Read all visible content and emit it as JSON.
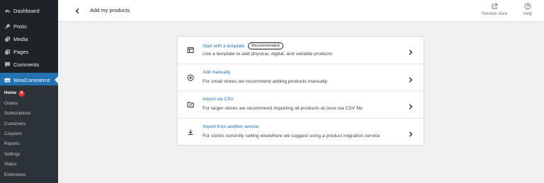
{
  "sidebar": {
    "menu": [
      {
        "label": "Dashboard",
        "icon": "dashboard-icon"
      },
      {
        "label": "Posts",
        "icon": "pushpin-icon"
      },
      {
        "label": "Media",
        "icon": "media-icon"
      },
      {
        "label": "Pages",
        "icon": "pages-icon"
      },
      {
        "label": "Comments",
        "icon": "comment-icon"
      },
      {
        "label": "WooCommerce",
        "icon": "woo-icon"
      }
    ],
    "submenu": [
      {
        "label": "Home",
        "badge": "5"
      },
      {
        "label": "Orders"
      },
      {
        "label": "Subscriptions"
      },
      {
        "label": "Customers"
      },
      {
        "label": "Coupons"
      },
      {
        "label": "Reports"
      },
      {
        "label": "Settings"
      },
      {
        "label": "Status"
      },
      {
        "label": "Extensions"
      }
    ]
  },
  "header": {
    "title": "Add my products",
    "preview_label": "Preview store",
    "help_label": "Help"
  },
  "options": [
    {
      "title": "Start with a template",
      "badge": "Recommended",
      "desc": "Use a template to add physical, digital, and variable products",
      "icon": "template-icon"
    },
    {
      "title": "Add manually",
      "desc": "For small stores we recommend adding products manually",
      "icon": "plus-circle-icon"
    },
    {
      "title": "Import via CSV",
      "desc": "For larger stores we recommend importing all products at once via CSV file",
      "icon": "folder-icon"
    },
    {
      "title": "Import from another service",
      "desc": "For stores currently selling elsewhere we suggest using a product migration service",
      "icon": "download-icon"
    }
  ],
  "colors": {
    "sidebar_bg": "#1d2327",
    "submenu_bg": "#2c3338",
    "accent": "#2271b1",
    "badge": "#d63638"
  }
}
